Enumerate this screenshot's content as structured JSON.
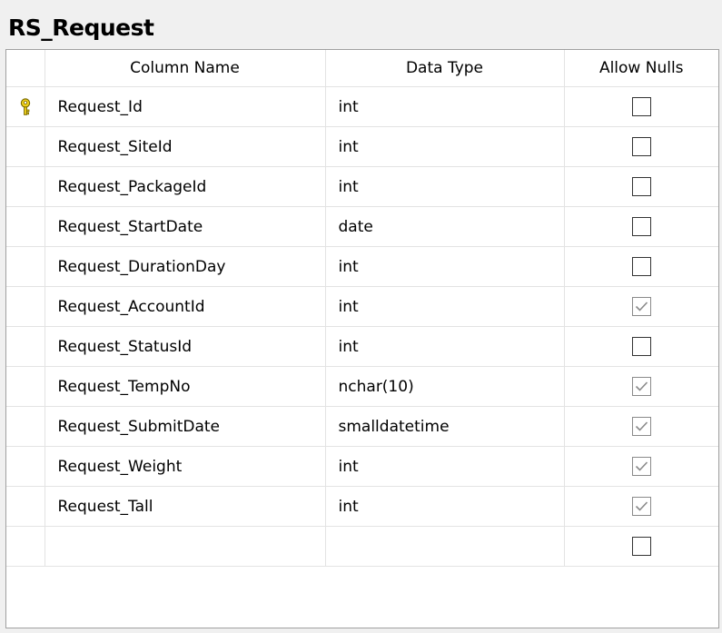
{
  "table": {
    "title": "RS_Request",
    "headers": {
      "column_name": "Column Name",
      "data_type": "Data Type",
      "allow_nulls": "Allow Nulls"
    },
    "rows": [
      {
        "name": "Request_Id",
        "type": "int",
        "allow_nulls": false,
        "primary_key": true
      },
      {
        "name": "Request_SiteId",
        "type": "int",
        "allow_nulls": false,
        "primary_key": false
      },
      {
        "name": "Request_PackageId",
        "type": "int",
        "allow_nulls": false,
        "primary_key": false
      },
      {
        "name": "Request_StartDate",
        "type": "date",
        "allow_nulls": false,
        "primary_key": false
      },
      {
        "name": "Request_DurationDay",
        "type": "int",
        "allow_nulls": false,
        "primary_key": false
      },
      {
        "name": "Request_AccountId",
        "type": "int",
        "allow_nulls": true,
        "primary_key": false
      },
      {
        "name": "Request_StatusId",
        "type": "int",
        "allow_nulls": false,
        "primary_key": false
      },
      {
        "name": "Request_TempNo",
        "type": "nchar(10)",
        "allow_nulls": true,
        "primary_key": false
      },
      {
        "name": "Request_SubmitDate",
        "type": "smalldatetime",
        "allow_nulls": true,
        "primary_key": false
      },
      {
        "name": "Request_Weight",
        "type": "int",
        "allow_nulls": true,
        "primary_key": false
      },
      {
        "name": "Request_Tall",
        "type": "int",
        "allow_nulls": true,
        "primary_key": false
      },
      {
        "name": "",
        "type": "",
        "allow_nulls": false,
        "primary_key": false
      }
    ]
  },
  "icons": {
    "primary_key": "key-icon",
    "checkbox_checked": "checkmark-icon"
  },
  "colors": {
    "key_fill": "#f2d21b",
    "key_outline": "#7a6a00",
    "check_stroke": "#8a8a8a",
    "grid_line": "#e3e3e3"
  }
}
